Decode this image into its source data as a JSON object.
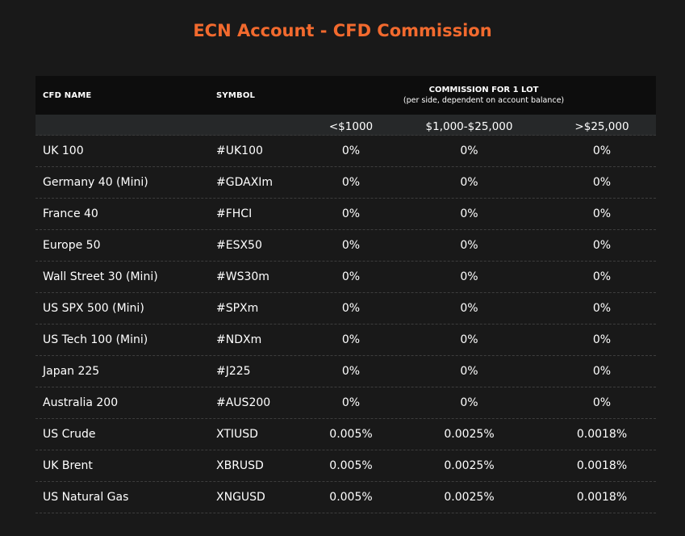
{
  "title": "ECN Account - CFD Commission",
  "table": {
    "headers": {
      "name": "CFD NAME",
      "symbol": "SYMBOL",
      "commission": "COMMISSION FOR 1 LOT",
      "commission_note": "(per side, dependent on account balance)",
      "tiers": [
        "<$1000",
        "$1,000-$25,000",
        ">$25,000"
      ]
    },
    "rows": [
      {
        "name": "UK 100",
        "symbol": "#UK100",
        "t1": "0%",
        "t2": "0%",
        "t3": "0%"
      },
      {
        "name": "Germany 40 (Mini)",
        "symbol": "#GDAXIm",
        "t1": "0%",
        "t2": "0%",
        "t3": "0%"
      },
      {
        "name": "France 40",
        "symbol": "#FHCI",
        "t1": "0%",
        "t2": "0%",
        "t3": "0%"
      },
      {
        "name": "Europe 50",
        "symbol": "#ESX50",
        "t1": "0%",
        "t2": "0%",
        "t3": "0%"
      },
      {
        "name": "Wall Street 30 (Mini)",
        "symbol": "#WS30m",
        "t1": "0%",
        "t2": "0%",
        "t3": "0%"
      },
      {
        "name": "US SPX 500 (Mini)",
        "symbol": "#SPXm",
        "t1": "0%",
        "t2": "0%",
        "t3": "0%"
      },
      {
        "name": "US Tech 100 (Mini)",
        "symbol": "#NDXm",
        "t1": "0%",
        "t2": "0%",
        "t3": "0%"
      },
      {
        "name": "Japan 225",
        "symbol": "#J225",
        "t1": "0%",
        "t2": "0%",
        "t3": "0%"
      },
      {
        "name": "Australia 200",
        "symbol": "#AUS200",
        "t1": "0%",
        "t2": "0%",
        "t3": "0%"
      },
      {
        "name": "US Crude",
        "symbol": "XTIUSD",
        "t1": "0.005%",
        "t2": "0.0025%",
        "t3": "0.0018%"
      },
      {
        "name": "UK Brent",
        "symbol": "XBRUSD",
        "t1": "0.005%",
        "t2": "0.0025%",
        "t3": "0.0018%"
      },
      {
        "name": "US Natural Gas",
        "symbol": "XNGUSD",
        "t1": "0.005%",
        "t2": "0.0025%",
        "t3": "0.0018%"
      }
    ]
  },
  "colors": {
    "accent": "#f26a2e",
    "background": "#191919",
    "header_bg": "#0d0d0d",
    "subheader_bg": "#262829"
  }
}
